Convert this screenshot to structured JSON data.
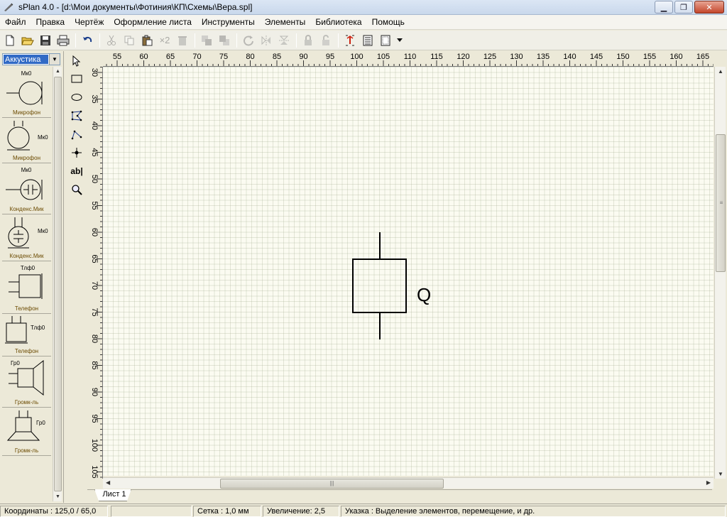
{
  "window": {
    "title": "sPlan 4.0 - [d:\\Мои документы\\Фотиния\\КП\\Схемы\\Вера.spl]"
  },
  "menu": {
    "items": [
      {
        "label": "Файл"
      },
      {
        "label": "Правка"
      },
      {
        "label": "Чертёж"
      },
      {
        "label": "Оформление листа"
      },
      {
        "label": "Инструменты"
      },
      {
        "label": "Элементы"
      },
      {
        "label": "Библиотека"
      },
      {
        "label": "Помощь"
      }
    ]
  },
  "toolbar": {
    "duplicate_label": "×2"
  },
  "library": {
    "category": "Аккустика",
    "components": [
      {
        "tag": "Мк0",
        "caption": "Микрофон"
      },
      {
        "tag": "Мк0",
        "caption": "Микрофон"
      },
      {
        "tag": "Мк0",
        "caption": "Конденс.Мик"
      },
      {
        "tag": "Мк0",
        "caption": "Конденс.Мик"
      },
      {
        "tag": "Тлф0",
        "caption": "Телефон"
      },
      {
        "tag": "Тлф0",
        "caption": "Телефон"
      },
      {
        "tag": "Гр0",
        "caption": "Громк-ль"
      },
      {
        "tag": "Гр0",
        "caption": "Громк-ль"
      }
    ]
  },
  "tools": {
    "text_tool_label": "ab|"
  },
  "rulers": {
    "horizontal": [
      "55",
      "60",
      "65",
      "70",
      "75",
      "80",
      "85",
      "90",
      "95",
      "100",
      "105",
      "110",
      "115",
      "120",
      "125",
      "130",
      "135",
      "140",
      "145",
      "150",
      "155",
      "160",
      "165"
    ],
    "vertical": [
      "30",
      "35",
      "40",
      "45",
      "50",
      "55",
      "60",
      "65",
      "70",
      "75",
      "80",
      "85",
      "90",
      "95",
      "100",
      "105"
    ]
  },
  "drawing": {
    "element_label": "Q"
  },
  "sheets": [
    {
      "label": "Лист 1"
    }
  ],
  "status": {
    "coords": "Координаты : 125,0 / 65,0",
    "grid": "Сетка : 1,0 мм",
    "zoom": "Увеличение: 2,5",
    "hint": "Указка : Выделение элементов, перемещение, и др."
  }
}
